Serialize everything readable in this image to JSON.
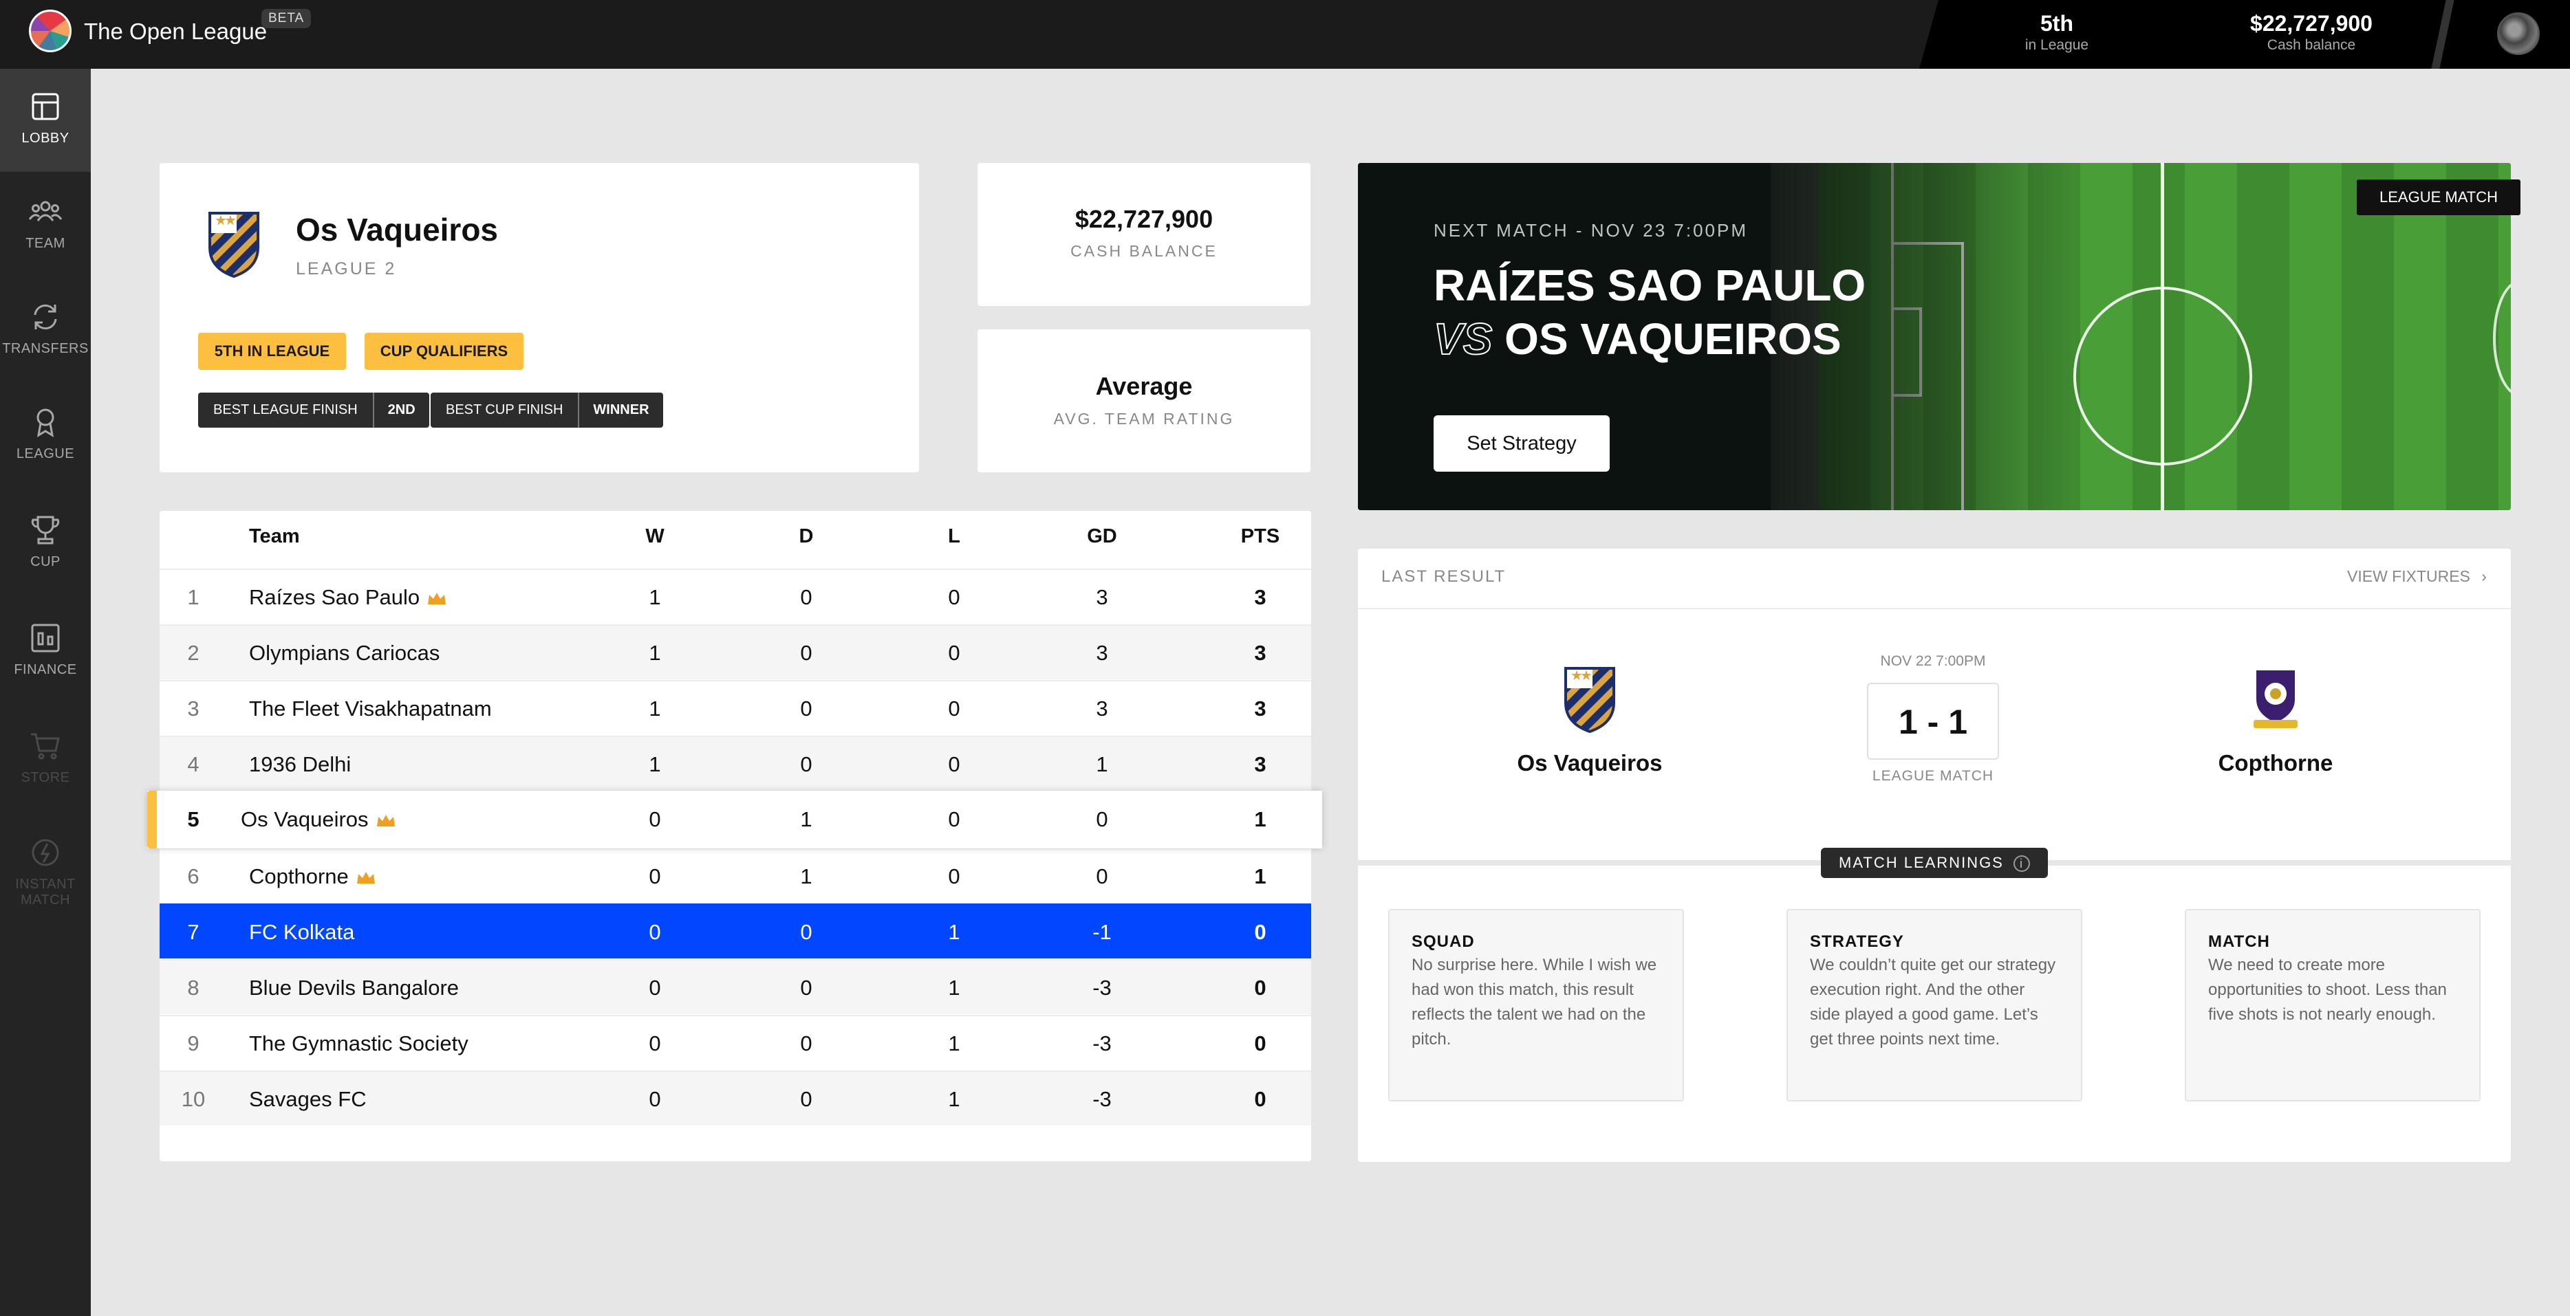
{
  "app": {
    "title": "The Open League",
    "beta": "BETA"
  },
  "header": {
    "position_value": "5th",
    "position_label": "in League",
    "cash_value": "$22,727,900",
    "cash_label": "Cash balance"
  },
  "sidebar": {
    "items": [
      {
        "label": "LOBBY",
        "icon": "lobby-icon",
        "state": "active"
      },
      {
        "label": "TEAM",
        "icon": "team-icon",
        "state": "normal"
      },
      {
        "label": "TRANSFERS",
        "icon": "transfers-icon",
        "state": "normal"
      },
      {
        "label": "LEAGUE",
        "icon": "league-icon",
        "state": "normal"
      },
      {
        "label": "CUP",
        "icon": "cup-icon",
        "state": "normal"
      },
      {
        "label": "FINANCE",
        "icon": "finance-icon",
        "state": "normal"
      },
      {
        "label": "STORE",
        "icon": "store-icon",
        "state": "disabled"
      },
      {
        "label": "INSTANT MATCH",
        "icon": "instant-match-icon",
        "state": "disabled"
      }
    ]
  },
  "team_card": {
    "name": "Os Vaqueiros",
    "league": "LEAGUE 2",
    "badges": [
      "5TH IN LEAGUE",
      "CUP QUALIFIERS"
    ],
    "best_league_finish_label": "BEST LEAGUE FINISH",
    "best_league_finish_value": "2ND",
    "best_cup_finish_label": "BEST CUP FINISH",
    "best_cup_finish_value": "WINNER"
  },
  "cash_card": {
    "value": "$22,727,900",
    "label": "CASH BALANCE"
  },
  "rating_card": {
    "value": "Average",
    "label": "AVG. TEAM RATING"
  },
  "standings": {
    "headers": {
      "team": "Team",
      "w": "W",
      "d": "D",
      "l": "L",
      "gd": "GD",
      "pts": "PTS"
    },
    "rows": [
      {
        "pos": "1",
        "team": "Raízes Sao Paulo",
        "w": "1",
        "d": "0",
        "l": "0",
        "gd": "3",
        "pts": "3"
      },
      {
        "pos": "2",
        "team": "Olympians Cariocas",
        "w": "1",
        "d": "0",
        "l": "0",
        "gd": "3",
        "pts": "3"
      },
      {
        "pos": "3",
        "team": "The Fleet Visakhapatnam",
        "w": "1",
        "d": "0",
        "l": "0",
        "gd": "3",
        "pts": "3"
      },
      {
        "pos": "4",
        "team": "1936 Delhi",
        "w": "1",
        "d": "0",
        "l": "0",
        "gd": "1",
        "pts": "3"
      },
      {
        "pos": "5",
        "team": "Os Vaqueiros",
        "w": "0",
        "d": "1",
        "l": "0",
        "gd": "0",
        "pts": "1"
      },
      {
        "pos": "6",
        "team": "Copthorne",
        "w": "0",
        "d": "1",
        "l": "0",
        "gd": "0",
        "pts": "1"
      },
      {
        "pos": "7",
        "team": "FC Kolkata",
        "w": "0",
        "d": "0",
        "l": "1",
        "gd": "-1",
        "pts": "0"
      },
      {
        "pos": "8",
        "team": "Blue Devils Bangalore",
        "w": "0",
        "d": "0",
        "l": "1",
        "gd": "-3",
        "pts": "0"
      },
      {
        "pos": "9",
        "team": "The Gymnastic Society",
        "w": "0",
        "d": "0",
        "l": "1",
        "gd": "-3",
        "pts": "0"
      },
      {
        "pos": "10",
        "team": "Savages FC",
        "w": "0",
        "d": "0",
        "l": "1",
        "gd": "-3",
        "pts": "0"
      }
    ]
  },
  "next_match": {
    "badge": "LEAGUE MATCH",
    "label": "NEXT MATCH - NOV 23 7:00PM",
    "home": "RAÍZES SAO PAULO",
    "vs": "VS",
    "away": "OS VAQUEIROS",
    "button": "Set Strategy"
  },
  "last_result": {
    "heading": "LAST RESULT",
    "view_fixtures": "VIEW FIXTURES",
    "date": "NOV 22 7:00PM",
    "home_team": "Os Vaqueiros",
    "away_team": "Copthorne",
    "score": "1 - 1",
    "match_type": "LEAGUE MATCH"
  },
  "learnings": {
    "title": "MATCH LEARNINGS",
    "cards": [
      {
        "title": "SQUAD",
        "text": "No surprise here. While I wish we had won this match, this result reflects the talent we had on the pitch."
      },
      {
        "title": "STRATEGY",
        "text": "We couldn’t quite get our strategy execution right. And the other side played a good game. Let’s get three points next time."
      },
      {
        "title": "MATCH",
        "text": "We need to create more opportunities to shoot. Less than five shots is not nearly enough."
      }
    ]
  },
  "colors": {
    "accent_yellow": "#fcbf3f",
    "selected_blue": "#0047ff",
    "crown_orange": "#f0a020"
  }
}
